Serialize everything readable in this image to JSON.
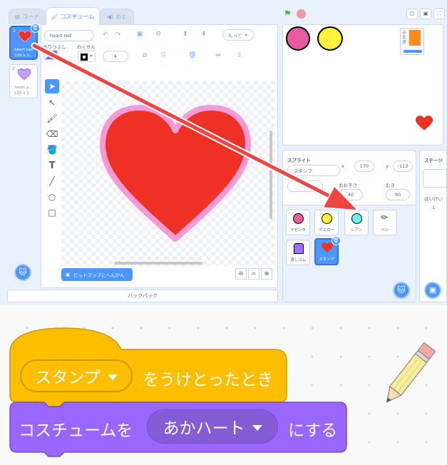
{
  "tabs": [
    {
      "icon": "code-icon",
      "label": "コード"
    },
    {
      "icon": "brush-icon",
      "label": "コスチューム"
    },
    {
      "icon": "speaker-icon",
      "label": "おと"
    }
  ],
  "costumes": [
    {
      "number": "1",
      "name": "heart red",
      "size": "129 x 1..."
    },
    {
      "number": "2",
      "name": "heart p...",
      "size": "133 x 1..."
    }
  ],
  "paint": {
    "costume_name": "heart red",
    "fill_label": "ぬりつぶし",
    "outline_label": "わくせん",
    "outline_width": "4",
    "more_label": "もっと",
    "bitmap_button": "ビットマップにへんかん",
    "zoom_equals": "="
  },
  "backpack_label": "バックパック",
  "sprite_info": {
    "section_label": "スプライト",
    "name": "スタンプ",
    "x_label": "x",
    "x_value": "170",
    "y_label": "y",
    "y_value": "-113",
    "size_label": "おおきさ",
    "size_value": "40",
    "direction_label": "むき",
    "direction_value": "90"
  },
  "sprites": [
    {
      "name": "マゼンタ",
      "color": "#e65ba0"
    },
    {
      "name": "イエロー",
      "color": "#fff23a"
    },
    {
      "name": "シアン",
      "color": "#6ef0f0"
    },
    {
      "name": "ペン",
      "color": "#e8d98c"
    },
    {
      "name": "消しゴム",
      "color": "#a06cff"
    },
    {
      "name": "スタンプ",
      "color": "#ee3124"
    }
  ],
  "stage_pane": {
    "label": "ステージ",
    "backdrop_label": "はいけい",
    "backdrop_count": "1"
  },
  "stage_items": {
    "circle1_color": "#e65ba0",
    "circle2_color": "#fff23a",
    "mini_label": "ふとき"
  },
  "blocks": {
    "hat_dropdown": "スタンプ",
    "hat_text": "をうけとったとき",
    "looks_prefix": "コスチュームを",
    "looks_dropdown": "あかハート",
    "looks_suffix": "にする"
  },
  "colors": {
    "accent": "#4c97ff",
    "events_block": "#ffbf00",
    "looks_block": "#9966ff",
    "arrow": "#ee4444",
    "heart_fill": "#ee3124",
    "heart_outline": "#f49ad8"
  }
}
